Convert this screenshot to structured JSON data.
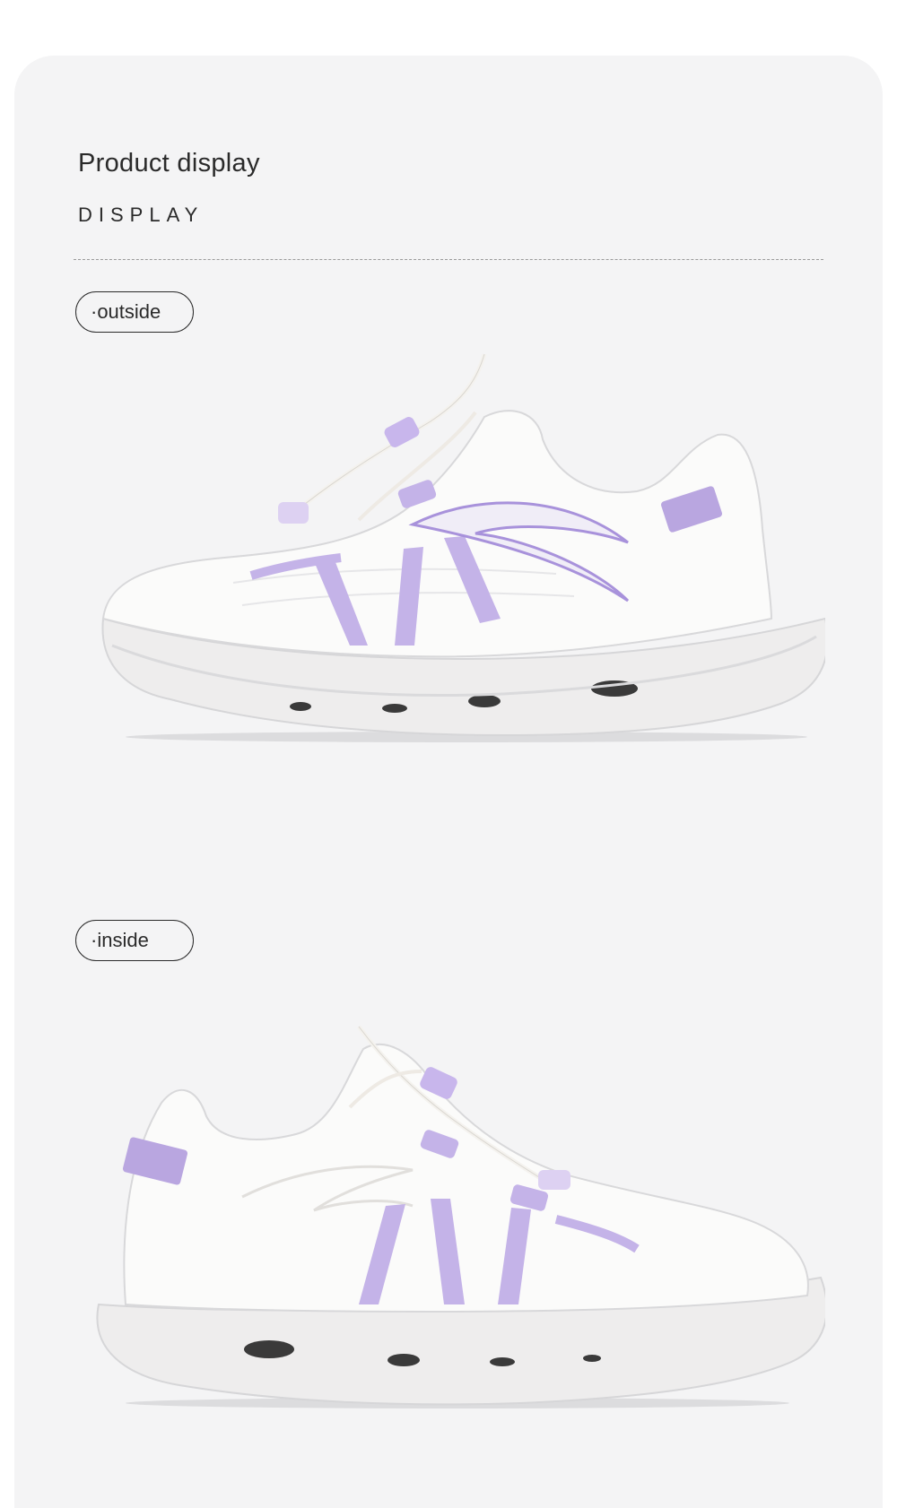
{
  "header": {
    "title": "Product display",
    "subtitle": "DISPLAY"
  },
  "sections": [
    {
      "label": "·outside",
      "image_alt": "white running shoe with lavender accents, outer side view"
    },
    {
      "label": "·inside",
      "image_alt": "white running shoe with lavender accents, inner side view"
    }
  ],
  "colors": {
    "panel": "#f4f4f5",
    "shoe_white": "#fbfbfa",
    "accent_lavender": "#b9a6e0",
    "text": "#2a2a2a"
  }
}
